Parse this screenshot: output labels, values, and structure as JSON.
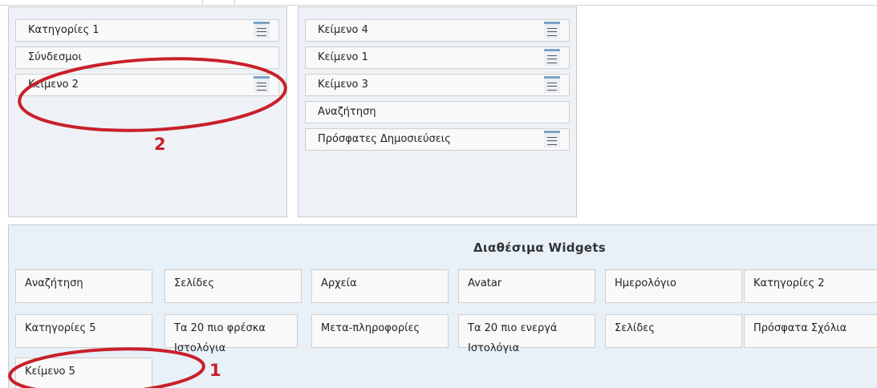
{
  "columns": [
    {
      "widgets": [
        {
          "label": "Κατηγορίες 1",
          "has_menu": true
        },
        {
          "label": "Σύνδεσμοι",
          "has_menu": false
        },
        {
          "label": "Κείμενο 2",
          "has_menu": true
        }
      ]
    },
    {
      "widgets": [
        {
          "label": "Κείμενο 4",
          "has_menu": true
        },
        {
          "label": "Κείμενο 1",
          "has_menu": true
        },
        {
          "label": "Κείμενο 3",
          "has_menu": true
        },
        {
          "label": "Αναζήτηση",
          "has_menu": false
        },
        {
          "label": "Πρόσφατες Δημοσιεύσεις",
          "has_menu": true
        }
      ]
    }
  ],
  "available": {
    "title": "Διαθέσιμα Widgets",
    "row1": [
      "Αναζήτηση",
      "Σελίδες",
      "Αρχεία",
      "Avatar",
      "Ημερολόγιο",
      "Κατηγορίες 2"
    ],
    "row2": [
      "Κατηγορίες 5",
      "Τα 20 πιο φρέσκα Ιστολόγια",
      "Μετα-πληροφορίες",
      "Τα 20 πιο ενεργά Ιστολόγια",
      "Σελίδες",
      "Πρόσφατα Σχόλια"
    ],
    "row3": [
      "Κείμενο 5"
    ]
  },
  "annotations": {
    "marker_1": "1",
    "marker_2": "2",
    "color": "#c8202a"
  },
  "colors": {
    "column_bg": "#eef2f7",
    "available_bg": "#e8f0f8",
    "menu_accent": "#7da3c8"
  }
}
